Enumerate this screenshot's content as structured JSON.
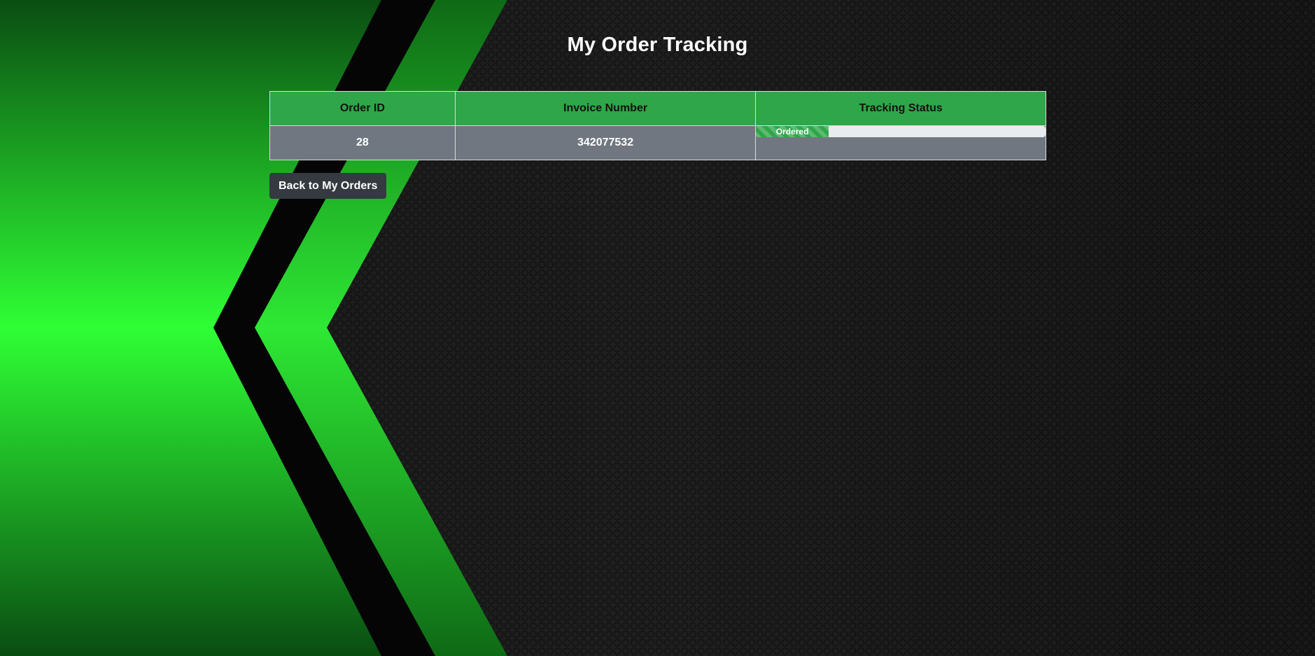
{
  "page": {
    "title": "My Order Tracking"
  },
  "table": {
    "headers": {
      "order_id": "Order ID",
      "invoice_number": "Invoice Number",
      "tracking_status": "Tracking Status"
    },
    "rows": [
      {
        "order_id": "28",
        "invoice_number": "342077532",
        "tracking_status": {
          "label": "Ordered",
          "progress_percent": 25
        }
      }
    ]
  },
  "actions": {
    "back_label": "Back to My Orders"
  },
  "colors": {
    "accent_green": "#2fa64a",
    "row_gray": "#707780",
    "button_dark": "#343a40",
    "background_dark": "#1a1a1a"
  }
}
